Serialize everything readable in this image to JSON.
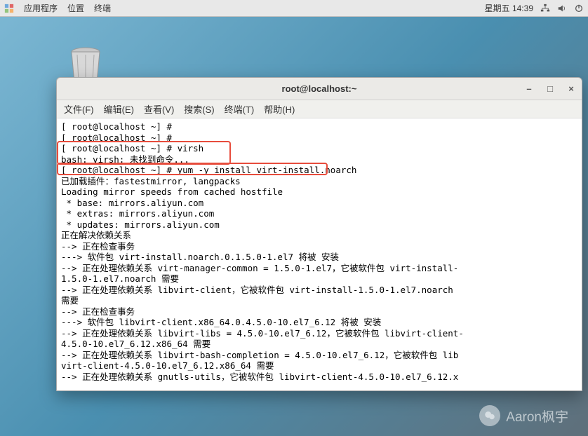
{
  "topbar": {
    "menus": [
      "应用程序",
      "位置",
      "终端"
    ],
    "clock": "星期五 14:39"
  },
  "desktop": {
    "trash_label": "trash"
  },
  "window": {
    "title": "root@localhost:~",
    "menus": [
      "文件(F)",
      "编辑(E)",
      "查看(V)",
      "搜索(S)",
      "终端(T)",
      "帮助(H)"
    ]
  },
  "terminal": {
    "lines": [
      "[ root@localhost ~] #",
      "[ root@localhost ~] #",
      "[ root@localhost ~] # virsh",
      "bash: virsh: 未找到命令...",
      "[ root@localhost ~] # yum -y install virt-install.noarch",
      "已加载插件：fastestmirror, langpacks",
      "Loading mirror speeds from cached hostfile",
      " * base: mirrors.aliyun.com",
      " * extras: mirrors.aliyun.com",
      " * updates: mirrors.aliyun.com",
      "正在解决依赖关系",
      "--> 正在检查事务",
      "---> 软件包 virt-install.noarch.0.1.5.0-1.el7 将被 安装",
      "--> 正在处理依赖关系 virt-manager-common = 1.5.0-1.el7，它被软件包 virt-install-",
      "1.5.0-1.el7.noarch 需要",
      "--> 正在处理依赖关系 libvirt-client，它被软件包 virt-install-1.5.0-1.el7.noarch",
      "需要",
      "--> 正在检查事务",
      "---> 软件包 libvirt-client.x86_64.0.4.5.0-10.el7_6.12 将被 安装",
      "--> 正在处理依赖关系 libvirt-libs = 4.5.0-10.el7_6.12，它被软件包 libvirt-client-",
      "4.5.0-10.el7_6.12.x86_64 需要",
      "--> 正在处理依赖关系 libvirt-bash-completion = 4.5.0-10.el7_6.12，它被软件包 lib",
      "virt-client-4.5.0-10.el7_6.12.x86_64 需要",
      "--> 正在处理依赖关系 gnutls-utils，它被软件包 libvirt-client-4.5.0-10.el7_6.12.x"
    ]
  },
  "watermark": {
    "text": "Aaron枫宇"
  }
}
